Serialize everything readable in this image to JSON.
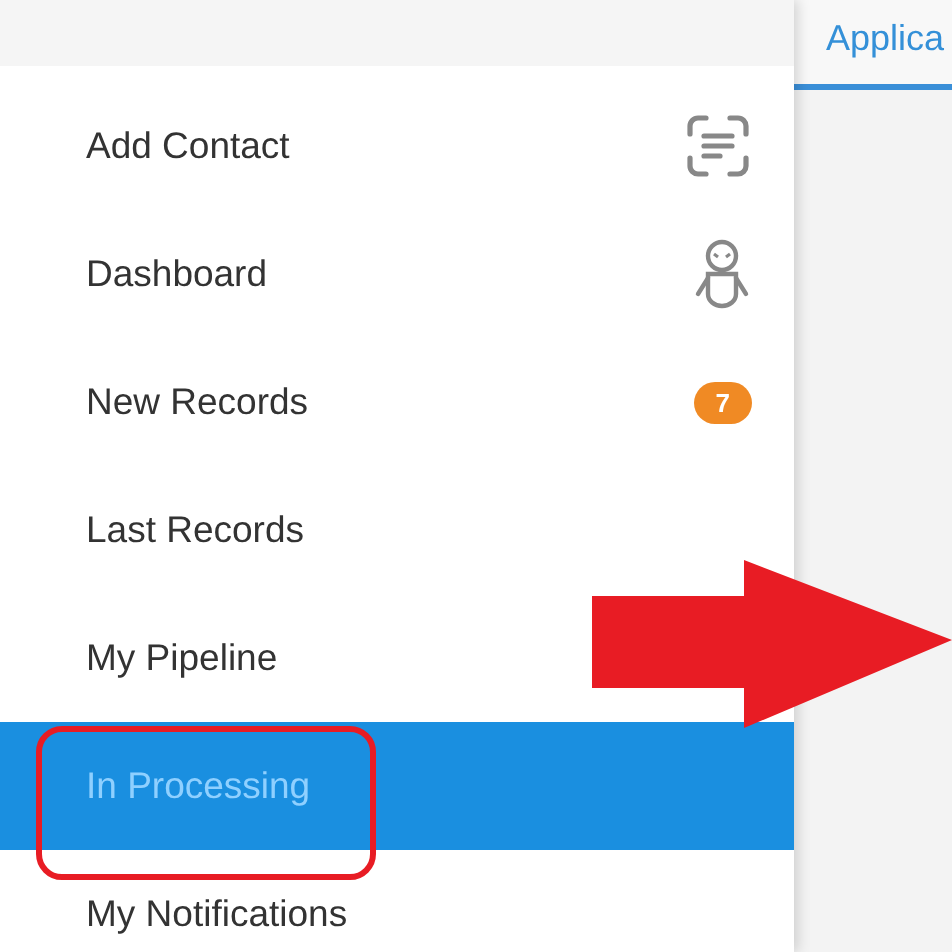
{
  "sidebar": {
    "items": [
      {
        "label": "Add Contact",
        "kind": "scan",
        "selected": false
      },
      {
        "label": "Dashboard",
        "kind": "robot",
        "selected": false
      },
      {
        "label": "New Records",
        "kind": "badge",
        "badge": "7",
        "selected": false
      },
      {
        "label": "Last Records",
        "kind": "plain",
        "selected": false
      },
      {
        "label": "My Pipeline",
        "kind": "plain",
        "selected": false
      },
      {
        "label": "In Processing",
        "kind": "plain",
        "selected": true
      },
      {
        "label": "My Notifications",
        "kind": "plain",
        "selected": false
      }
    ]
  },
  "main": {
    "tabs": [
      {
        "label": "Applica",
        "selected": true
      }
    ]
  },
  "annotations": {
    "arrow": true,
    "highlight_frame": true
  }
}
